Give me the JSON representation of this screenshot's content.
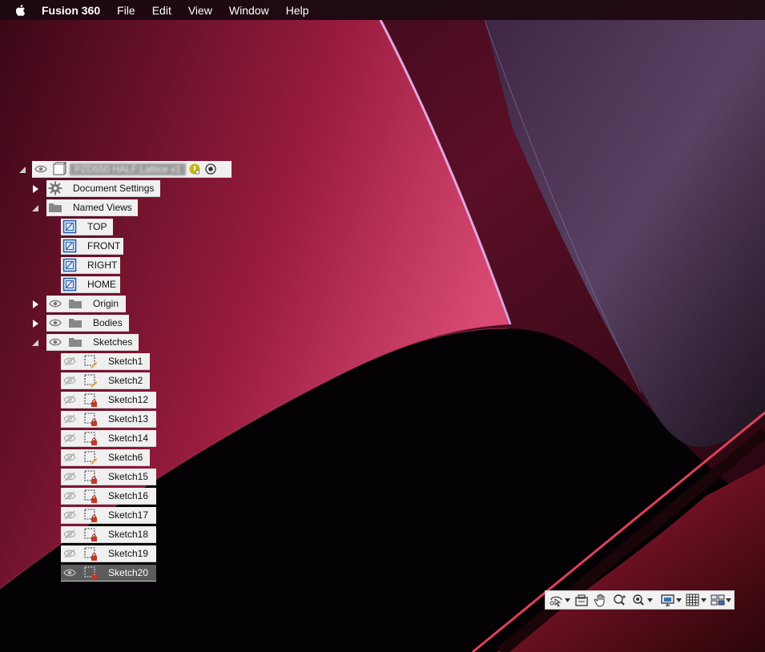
{
  "menubar": {
    "app_name": "Fusion 360",
    "items": [
      "File",
      "Edit",
      "View",
      "Window",
      "Help"
    ]
  },
  "browser": {
    "root": {
      "name": "PZD550 HALF Lattice v1"
    },
    "document_settings": "Document Settings",
    "named_views": {
      "label": "Named Views",
      "items": [
        "TOP",
        "FRONT",
        "RIGHT",
        "HOME"
      ]
    },
    "origin": "Origin",
    "bodies": "Bodies",
    "sketches": {
      "label": "Sketches",
      "items": [
        "Sketch1",
        "Sketch2",
        "Sketch12",
        "Sketch13",
        "Sketch14",
        "Sketch6",
        "Sketch15",
        "Sketch16",
        "Sketch17",
        "Sketch18",
        "Sketch19",
        "Sketch20"
      ]
    }
  },
  "navbar": {
    "tools": [
      "orbit-icon",
      "look-at-icon",
      "pan-icon",
      "zoom-icon",
      "fit-icon",
      "display-settings-icon",
      "grid-icon",
      "viewports-icon"
    ]
  },
  "colors": {
    "chip_bg": "#f0f0f0",
    "selected_bg": "#5c5c5c",
    "sketch_lock": "#c0392b",
    "sketch_pencil": "#e6a23c",
    "named_view_blue": "#2a5ea8"
  }
}
